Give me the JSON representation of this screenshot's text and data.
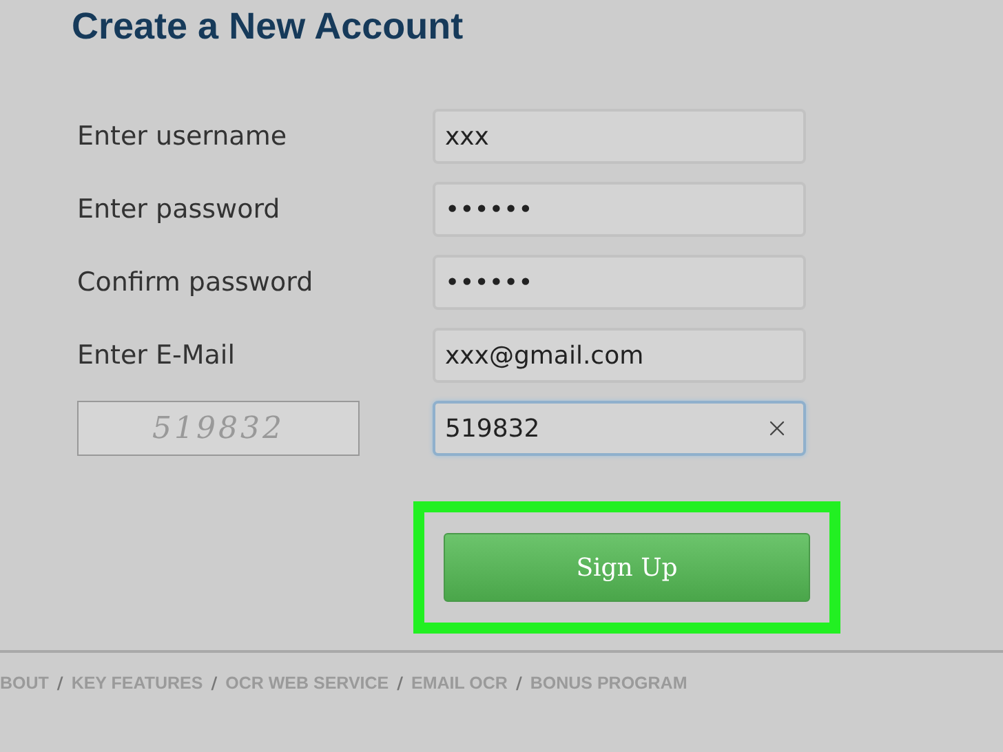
{
  "title": "Create a New Account",
  "fields": [
    {
      "label": "Enter username",
      "value": "xxx",
      "focused": false
    },
    {
      "label": "Enter password",
      "value": "••••••",
      "focused": false
    },
    {
      "label": "Confirm password",
      "value": "••••••",
      "focused": false
    },
    {
      "label": "Enter E-Mail",
      "value": "xxx@gmail.com",
      "focused": false
    }
  ],
  "captcha": {
    "code": "519832",
    "value": "519832",
    "focused": true
  },
  "button": {
    "label": "Sign Up",
    "highlighted": true
  },
  "footer_links": [
    "BOUT",
    "KEY FEATURES",
    "OCR WEB SERVICE",
    "EMAIL OCR",
    "BONUS PROGRAM"
  ],
  "footer_separator": "/"
}
